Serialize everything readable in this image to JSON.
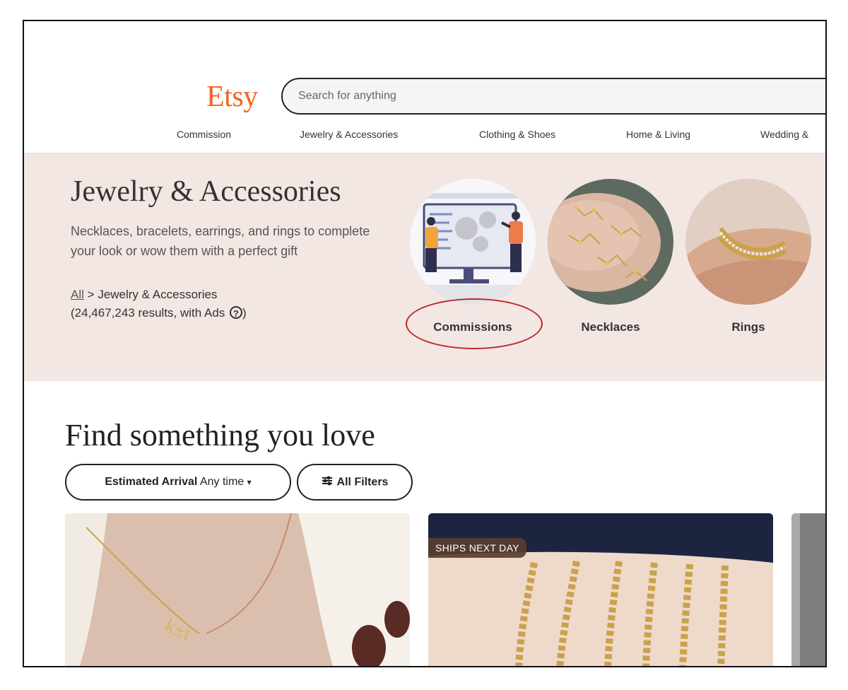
{
  "header": {
    "logo": "Etsy",
    "search": {
      "placeholder": "Search for anything"
    },
    "nav": [
      "Commission",
      "Jewelry & Accessories",
      "Clothing & Shoes",
      "Home & Living",
      "Wedding &"
    ]
  },
  "hero": {
    "title": "Jewelry & Accessories",
    "description": "Necklaces, bracelets, earrings, and rings to complete your look or wow them with a perfect gift",
    "breadcrumb": {
      "all": "All",
      "separator": ">",
      "current": "Jewelry & Accessories"
    },
    "results": "(24,467,243 results, with Ads",
    "results_close": ")",
    "help_icon_glyph": "?",
    "categories": [
      {
        "label": "Commissions",
        "icon": "commission-illustration",
        "highlighted": true
      },
      {
        "label": "Necklaces",
        "icon": "necklaces-photo"
      },
      {
        "label": "Rings",
        "icon": "rings-photo"
      }
    ]
  },
  "find": {
    "title": "Find something you love",
    "filters": {
      "arrival_label": "Estimated Arrival",
      "arrival_value": "Any time",
      "arrival_caret": "▾",
      "all_filters": "All Filters"
    }
  },
  "listings": [
    {
      "badge": "",
      "image": "necklace-photo"
    },
    {
      "badge": "SHIPS NEXT DAY",
      "image": "bracelets-photo"
    },
    {
      "badge": "",
      "image": "gray-photo"
    }
  ],
  "colors": {
    "brand": "#f1641e",
    "hero_bg": "#f3e7e3",
    "annotation": "#c0282a"
  }
}
